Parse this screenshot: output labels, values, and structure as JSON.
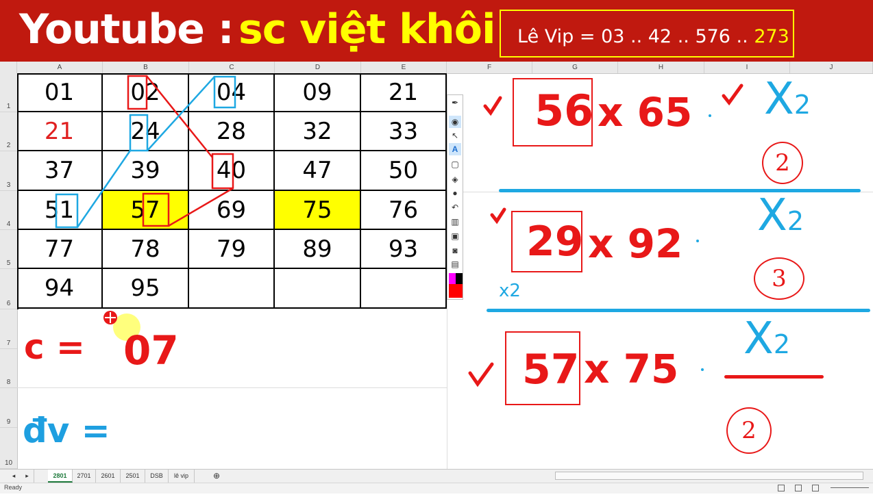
{
  "banner": {
    "title_prefix": "Youtube :",
    "channel_name": "sc việt khôi",
    "vip_text": "Lê Vip = 03 .. 42 .. 576 ..",
    "vip_highlight": "273"
  },
  "columns": [
    "A",
    "B",
    "C",
    "D",
    "E",
    "F",
    "G",
    "H",
    "I",
    "J"
  ],
  "rows": [
    "1",
    "2",
    "3",
    "4",
    "5",
    "6",
    "7",
    "8",
    "9",
    "10"
  ],
  "grid": [
    [
      "01",
      "02",
      "04",
      "09",
      "21"
    ],
    [
      "21",
      "24",
      "28",
      "32",
      "33"
    ],
    [
      "37",
      "39",
      "40",
      "47",
      "50"
    ],
    [
      "51",
      "57",
      "69",
      "75",
      "76"
    ],
    [
      "77",
      "78",
      "79",
      "89",
      "93"
    ],
    [
      "94",
      "95",
      "",
      "",
      ""
    ]
  ],
  "formulas": {
    "c_label": "c =",
    "c_value": "07",
    "dv_label": "đv ="
  },
  "annotations": {
    "pair1_a": "56",
    "pair1_b": "x 65",
    "pair2_a": "29",
    "pair2_b": "x 92",
    "pair3_a": "57",
    "pair3_b": "x 75",
    "x2_label": "X",
    "x2_sub": "2",
    "small_x2": "x2",
    "circle1": "2",
    "circle2": "3",
    "circle3": "2",
    "check": "✓"
  },
  "sheet_tabs": [
    "2801",
    "2701",
    "2601",
    "2501",
    "DSB",
    "lê vip"
  ],
  "active_tab": "2801",
  "status": {
    "ready": "Ready"
  },
  "colors": {
    "banner_bg": "#c0190f",
    "channel_yellow": "#ffff00",
    "ink_red": "#e81818",
    "ink_blue": "#1ea8e2",
    "highlight_yellow": "#ffff00"
  }
}
